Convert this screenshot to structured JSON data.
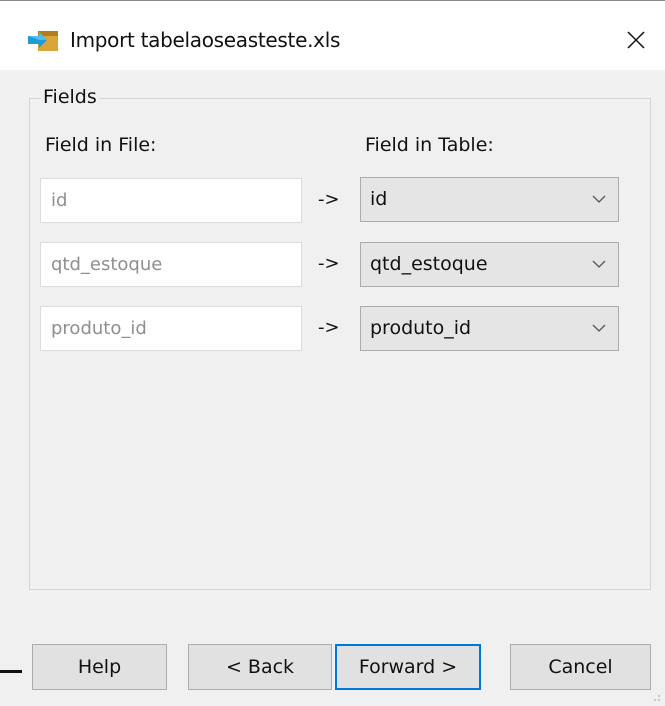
{
  "window": {
    "title": "Import tabelaoseasteste.xls",
    "close_symbol": "✕"
  },
  "fields": {
    "legend": "Fields",
    "file_header": "Field in File:",
    "table_header": "Field in Table:",
    "arrow": "->",
    "rows": [
      {
        "file_field": "id",
        "table_field": "id"
      },
      {
        "file_field": "qtd_estoque",
        "table_field": "qtd_estoque"
      },
      {
        "file_field": "produto_id",
        "table_field": "produto_id"
      }
    ]
  },
  "buttons": {
    "help": "Help",
    "back": "< Back",
    "forward": "Forward >",
    "cancel": "Cancel"
  },
  "colors": {
    "accent": "#0078d7",
    "dialog_bg": "#f0f0f0",
    "button_bg": "#e1e1e1"
  },
  "icons": {
    "title_icon": "import-arrow-icon",
    "close_icon": "close-icon",
    "dropdown_icon": "chevron-down-icon",
    "grip_icon": "resize-grip-icon"
  }
}
